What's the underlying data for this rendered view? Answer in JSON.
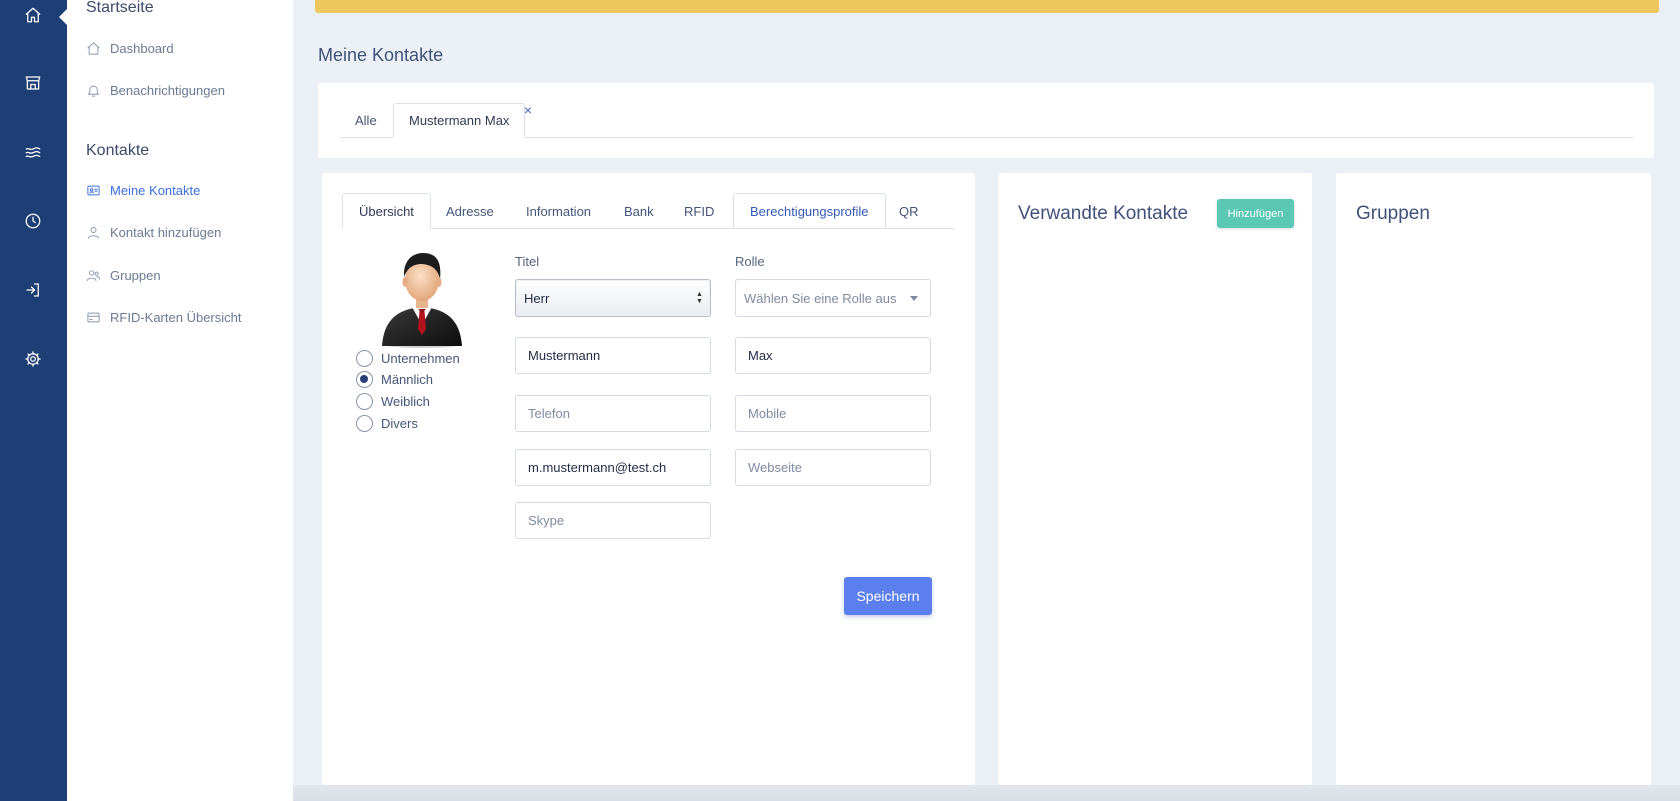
{
  "sidebar": {
    "section_home": "Startseite",
    "home_items": [
      {
        "label": "Dashboard",
        "icon": "house-icon"
      },
      {
        "label": "Benachrichtigungen",
        "icon": "bell-icon"
      }
    ],
    "section_contacts": "Kontakte",
    "contact_items": [
      {
        "label": "Meine Kontakte",
        "icon": "id-card-icon",
        "active": true
      },
      {
        "label": "Kontakt hinzufügen",
        "icon": "person-icon"
      },
      {
        "label": "Gruppen",
        "icon": "people-icon"
      },
      {
        "label": "RFID-Karten Übersicht",
        "icon": "card-icon"
      }
    ]
  },
  "rail": {
    "icons": [
      "home-icon",
      "store-icon",
      "waves-icon",
      "clock-icon",
      "login-icon",
      "gear-icon"
    ]
  },
  "page": {
    "title": "Meine Kontakte"
  },
  "outer_tabs": {
    "all": "Alle",
    "contact": "Mustermann Max",
    "close": "×"
  },
  "inner_tabs": [
    "Übersicht",
    "Adresse",
    "Information",
    "Bank",
    "RFID",
    "Berechtigungsprofile",
    "QR"
  ],
  "form": {
    "gender_options": [
      {
        "label": "Unternehmen",
        "checked": false
      },
      {
        "label": "Männlich",
        "checked": true
      },
      {
        "label": "Weiblich",
        "checked": false
      },
      {
        "label": "Divers",
        "checked": false
      }
    ],
    "titel_label": "Titel",
    "titel_value": "Herr",
    "rolle_label": "Rolle",
    "rolle_placeholder": "Wählen Sie eine Rolle aus",
    "lastname_value": "Mustermann",
    "firstname_value": "Max",
    "telefon_placeholder": "Telefon",
    "mobile_placeholder": "Mobile",
    "email_value": "m.mustermann@test.ch",
    "webseite_placeholder": "Webseite",
    "skype_placeholder": "Skype",
    "save_label": "Speichern"
  },
  "related": {
    "title": "Verwandte Kontakte",
    "add_label": "Hinzufügen"
  },
  "groups": {
    "title": "Gruppen"
  },
  "colors": {
    "rail": "#1e3f75",
    "warning": "#edc75b",
    "primary": "#5b7fef",
    "teal": "#5bc8b4",
    "active_link": "#3d6ee2"
  }
}
